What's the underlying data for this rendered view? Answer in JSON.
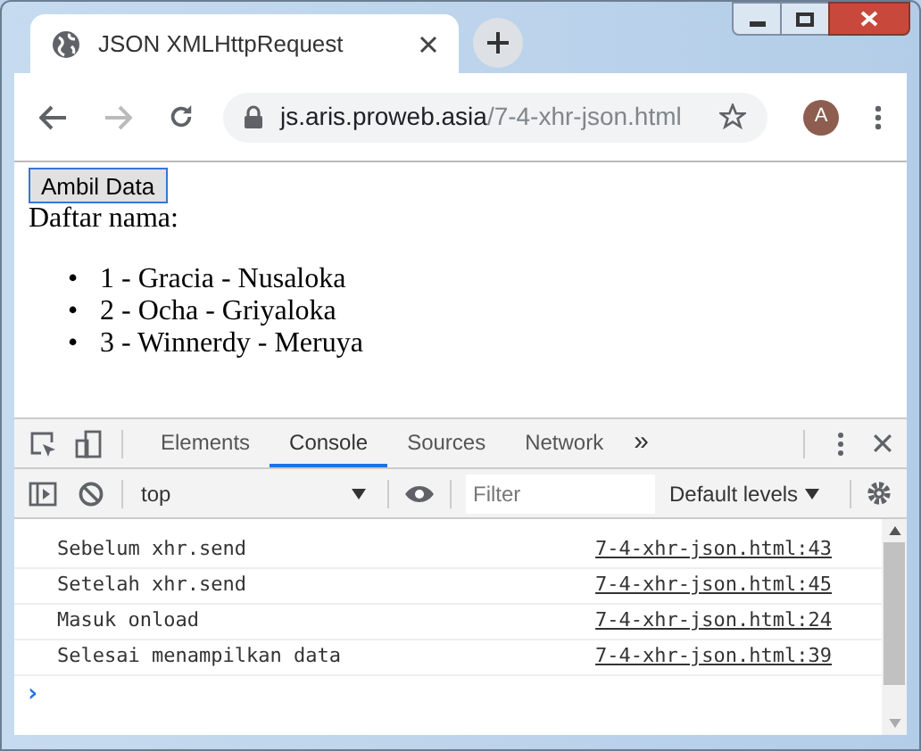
{
  "tab": {
    "title": "JSON XMLHttpRequest"
  },
  "address": {
    "host": "js.aris.proweb.asia",
    "path": "/7-4-xhr-json.html"
  },
  "avatar": "A",
  "page": {
    "button": "Ambil Data",
    "heading": "Daftar nama:",
    "items": [
      {
        "marker": "•",
        "text": "1 - Gracia - Nusaloka"
      },
      {
        "marker": "•",
        "text": "2 - Ocha - Griyaloka"
      },
      {
        "marker": "•",
        "text": "3 - Winnerdy - Meruya"
      }
    ]
  },
  "devtools": {
    "tabs": [
      {
        "label": "Elements",
        "selected": false
      },
      {
        "label": "Console",
        "selected": true
      },
      {
        "label": "Sources",
        "selected": false
      },
      {
        "label": "Network",
        "selected": false
      }
    ],
    "more": "»",
    "context": "top",
    "filter_placeholder": "Filter",
    "levels": "Default levels",
    "messages": [
      {
        "text": "Sebelum xhr.send",
        "source": "7-4-xhr-json.html:43"
      },
      {
        "text": "Setelah xhr.send",
        "source": "7-4-xhr-json.html:45"
      },
      {
        "text": "Masuk onload",
        "source": "7-4-xhr-json.html:24"
      },
      {
        "text": "Selesai menampilkan data",
        "source": "7-4-xhr-json.html:39"
      }
    ],
    "prompt": "›"
  }
}
